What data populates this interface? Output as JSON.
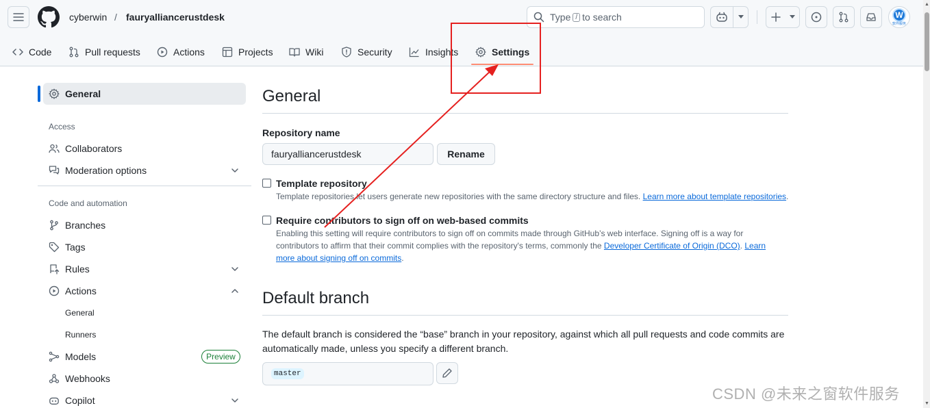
{
  "header": {
    "owner": "cyberwin",
    "separator": "/",
    "repo": "fauryalliancerustdesk",
    "search": {
      "prefix": "Type",
      "key": "/",
      "suffix": "to search"
    },
    "avatar_letter": "W",
    "avatar_caption": "软件服务"
  },
  "tabs": [
    {
      "label": "Code",
      "icon": "code-icon"
    },
    {
      "label": "Pull requests",
      "icon": "git-pull-request-icon"
    },
    {
      "label": "Actions",
      "icon": "play-icon"
    },
    {
      "label": "Projects",
      "icon": "table-icon"
    },
    {
      "label": "Wiki",
      "icon": "book-icon"
    },
    {
      "label": "Security",
      "icon": "shield-icon"
    },
    {
      "label": "Insights",
      "icon": "graph-icon"
    },
    {
      "label": "Settings",
      "icon": "gear-icon",
      "active": true
    }
  ],
  "sidebar": {
    "general": "General",
    "access_heading": "Access",
    "collaborators": "Collaborators",
    "moderation": "Moderation options",
    "code_heading": "Code and automation",
    "branches": "Branches",
    "tags": "Tags",
    "rules": "Rules",
    "actions": "Actions",
    "actions_general": "General",
    "actions_runners": "Runners",
    "models": "Models",
    "models_badge": "Preview",
    "webhooks": "Webhooks",
    "copilot": "Copilot"
  },
  "main": {
    "general_title": "General",
    "repo_name_label": "Repository name",
    "repo_name_value": "fauryalliancerustdesk",
    "rename_button": "Rename",
    "template": {
      "label": "Template repository",
      "note": "Template repositories let users generate new repositories with the same directory structure and files.",
      "link": "Learn more about template repositories",
      "end": "."
    },
    "signoff": {
      "label": "Require contributors to sign off on web-based commits",
      "note_line1": "Enabling this setting will require contributors to sign off on commits made through GitHub’s web interface. Signing off is a way for",
      "note_line2_pre": "contributors to affirm that their commit complies with the repository's terms, commonly the",
      "dco_link": "Developer Certificate of Origin (DCO)",
      "mid": ".",
      "learn_a": "Learn",
      "learn_b": "more about signing off on commits",
      "end": "."
    },
    "default_branch_title": "Default branch",
    "default_branch_desc": "The default branch is considered the “base” branch in your repository, against which all pull requests and code commits are automatically made, unless you specify a different branch.",
    "branch_name": "master"
  },
  "watermark": "CSDN @未来之窗软件服务",
  "colors": {
    "accent_blue": "#0969da",
    "tab_underline": "#fd8c73",
    "annotation_red": "#e5201f",
    "preview_green": "#1a7f37"
  }
}
